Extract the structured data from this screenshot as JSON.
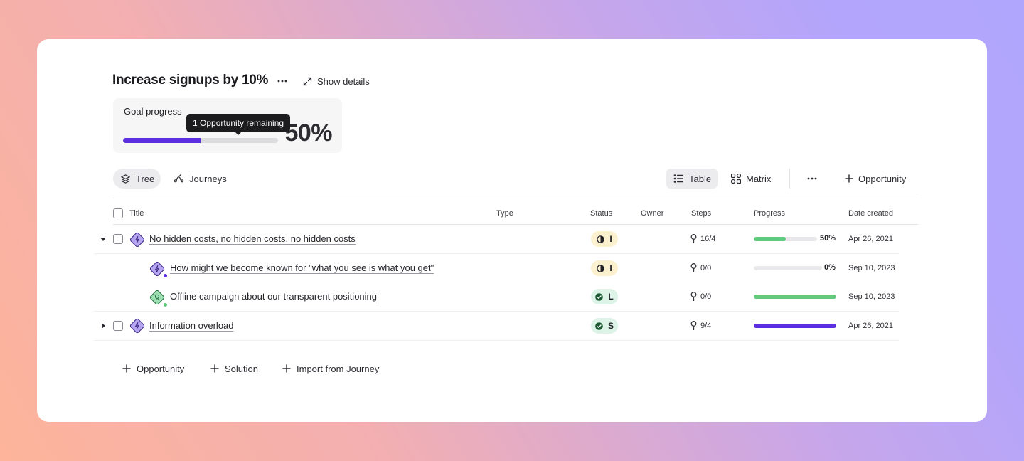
{
  "header": {
    "title": "Increase signups by 10%",
    "more_icon": "ellipsis-icon",
    "show_details_label": "Show details",
    "show_details_icon": "expand-icon"
  },
  "goal_progress": {
    "label": "Goal progress",
    "percent_text": "50%",
    "percent_value": 50,
    "fill_color": "#5b2fe0",
    "tooltip": "1 Opportunity remaining"
  },
  "tabs": [
    {
      "label": "Tree",
      "icon": "layers-icon",
      "active": true
    },
    {
      "label": "Journeys",
      "icon": "journey-icon",
      "active": false
    }
  ],
  "views": [
    {
      "label": "Table",
      "icon": "list-icon",
      "active": true
    },
    {
      "label": "Matrix",
      "icon": "matrix-icon",
      "active": false
    }
  ],
  "toolbar": {
    "more_icon": "ellipsis-icon",
    "add_label": "Opportunity",
    "add_icon": "plus-icon"
  },
  "table": {
    "columns": [
      "Title",
      "Type",
      "Status",
      "Owner",
      "Steps",
      "Progress",
      "Date created"
    ],
    "rows": [
      {
        "title": "No hidden costs, no hidden costs, no hidden costs",
        "level": 0,
        "expanded": true,
        "kind": "opportunity",
        "status_icon": "half-circle-icon",
        "status_letter": "I",
        "status_color": "yellow",
        "steps": "16/4",
        "progress": 50,
        "progress_text": "50%",
        "progress_color": "#62c97c",
        "date": "Apr 26, 2021"
      },
      {
        "title": "How might we become known for \"what you see is what you get\"",
        "level": 1,
        "kind": "opportunity",
        "status_icon": "half-circle-icon",
        "status_letter": "I",
        "status_color": "yellow",
        "steps": "0/0",
        "progress": 0,
        "progress_text": "0%",
        "progress_color": "#62c97c",
        "date": "Sep 10, 2023"
      },
      {
        "title": "Offline campaign about our transparent positioning",
        "level": 1,
        "kind": "solution",
        "status_icon": "check-circle-icon",
        "status_letter": "L",
        "status_color": "green",
        "steps": "0/0",
        "progress": 100,
        "progress_text": "",
        "progress_color": "#62c97c",
        "date": "Sep 10, 2023"
      },
      {
        "title": "Information overload",
        "level": 0,
        "expanded": false,
        "kind": "opportunity",
        "status_icon": "check-circle-icon",
        "status_letter": "S",
        "status_color": "green",
        "steps": "9/4",
        "progress": 100,
        "progress_text": "",
        "progress_color": "#5b2fe0",
        "date": "Apr 26, 2021"
      }
    ]
  },
  "footer": {
    "add_opportunity": "Opportunity",
    "add_solution": "Solution",
    "import_journey": "Import from Journey"
  },
  "colors": {
    "accent": "#5b2fe0",
    "progress_green": "#62c97c",
    "opportunity_icon": "#b6a6f2",
    "solution_icon": "#9ee0b4"
  }
}
